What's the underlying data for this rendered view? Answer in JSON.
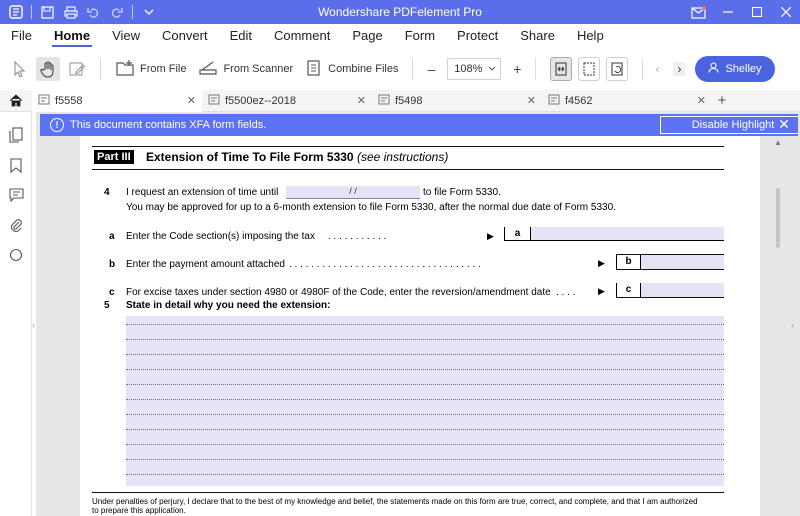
{
  "titlebar": {
    "title": "Wondershare PDFelement Pro"
  },
  "menu": [
    "File",
    "Home",
    "View",
    "Convert",
    "Edit",
    "Comment",
    "Page",
    "Form",
    "Protect",
    "Share",
    "Help"
  ],
  "toolbar": {
    "from_file": "From File",
    "from_scanner": "From Scanner",
    "combine_files": "Combine Files",
    "zoom": "108%",
    "user": "Shelley"
  },
  "tabs": [
    "f5558",
    "f5500ez--2018",
    "f5498",
    "f4562"
  ],
  "notice": {
    "text": "This document contains XFA form fields.",
    "button": "Disable Highlight"
  },
  "form": {
    "part_tag": "Part III",
    "part_title": "Extension of Time To File Form 5330",
    "part_title_note": "(see instructions)",
    "line4_num": "4",
    "line4_text_a": "I request an extension of time until",
    "line4_text_b": "to file Form 5330.",
    "date_placeholder": "/          /",
    "line4_text_c": "You may be approved for up to a 6-month extension to file Form 5330, after the normal due date of Form 5330.",
    "line_a_label": "a",
    "line_a_text": "Enter the Code section(s) imposing the tax",
    "line_a_dots": ". . . . . . . . . . .",
    "line_b_label": "b",
    "line_b_text": "Enter the payment amount attached",
    "line_b_dots": ". . . . . . . . . . . . . . . . . . . . . . . . . . . . . . . . . . .",
    "line_c_label": "c",
    "line_c_text": "For excise taxes under section 4980 or 4980F of the Code, enter the reversion/amendment date",
    "line_c_dots": ". . . .",
    "line5_num": "5",
    "line5_text": "State in detail why you need the extension:",
    "penalty_text": "Under penalties of perjury, I declare that to the best of my knowledge and belief, the statements made on this form are true, correct, and complete, and that I am authorized",
    "penalty_text2": "to prepare this application."
  }
}
